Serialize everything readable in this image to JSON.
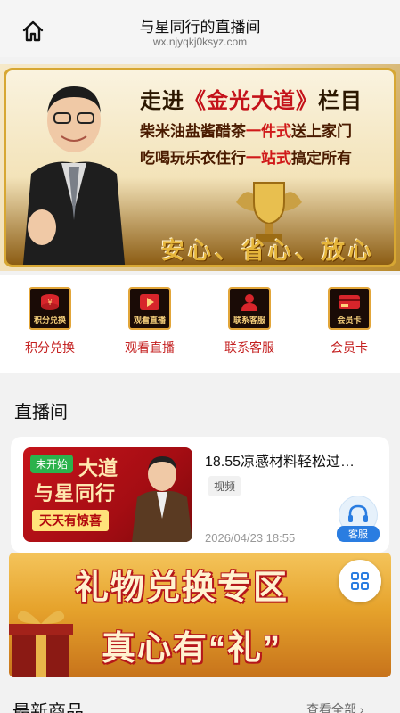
{
  "header": {
    "title": "与星同行的直播间",
    "url": "wx.njyqkj0ksyz.com"
  },
  "banner": {
    "line1_pre": "走进",
    "line1_mid": "《金光大道》",
    "line1_post": "栏目",
    "line2_pre": "柴米油盐酱醋茶",
    "line2_red": "一件式",
    "line2_post": "送上家门",
    "line3_pre": "吃喝玩乐衣住行",
    "line3_red": "一站式",
    "line3_post": "搞定所有",
    "slogan": "安心、省心、放心"
  },
  "quick_links": [
    {
      "label": "积分兑换",
      "cap": "积分兑换",
      "icon": "coins-icon"
    },
    {
      "label": "观看直播",
      "cap": "观看直播",
      "icon": "play-icon"
    },
    {
      "label": "联系客服",
      "cap": "联系客服",
      "icon": "support-person-icon"
    },
    {
      "label": "会员卡",
      "cap": "会员卡",
      "icon": "card-icon"
    }
  ],
  "live_section": {
    "heading": "直播间",
    "card": {
      "badge": "未开始",
      "thumb_line0": "大道",
      "thumb_line1": "与星同行",
      "thumb_line2": "天天有惊喜",
      "title": "18.55凉感材料轻松过…",
      "tag": "视频",
      "time": "2026/04/23 18:55"
    }
  },
  "service_button": {
    "label": "客服",
    "icon": "headset-icon"
  },
  "gift_banner": {
    "title1": "礼物兑换专区",
    "title2": "真心有“礼”"
  },
  "grid_button": {
    "icon": "grid-icon"
  },
  "products_section": {
    "heading": "最新商品",
    "more": "查看全部 ›"
  },
  "colors": {
    "accent_red": "#c41f1f",
    "badge_green": "#2bb24c",
    "gold": "#d7a733"
  }
}
